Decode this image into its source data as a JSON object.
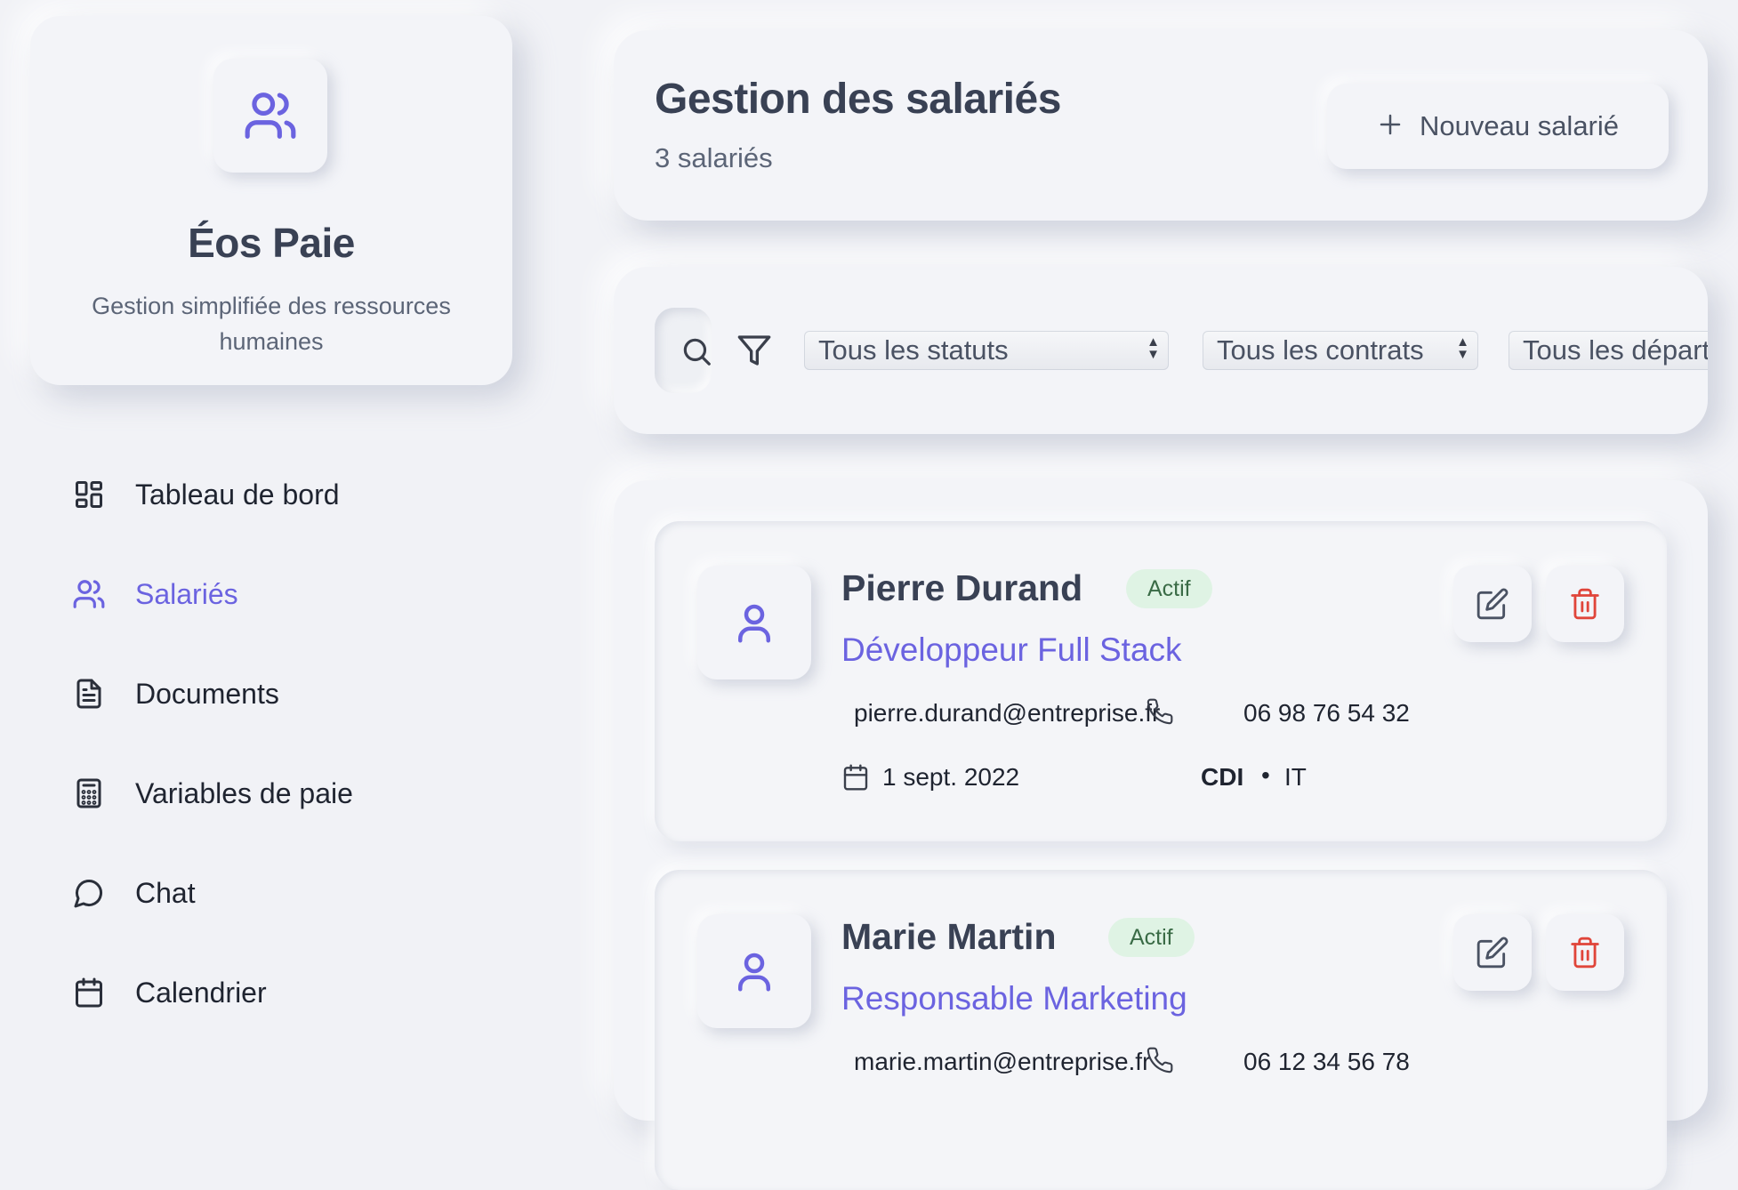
{
  "brand": {
    "name": "Éos Paie",
    "subtitle": "Gestion simplifiée des ressources humaines",
    "icon": "users-icon"
  },
  "sidebar": {
    "items": [
      {
        "label": "Tableau de bord",
        "icon": "dashboard-grid-icon",
        "active": false
      },
      {
        "label": "Salariés",
        "icon": "users-icon",
        "active": true
      },
      {
        "label": "Documents",
        "icon": "document-icon",
        "active": false
      },
      {
        "label": "Variables de paie",
        "icon": "calculator-icon",
        "active": false
      },
      {
        "label": "Chat",
        "icon": "chat-bubble-icon",
        "active": false
      },
      {
        "label": "Calendrier",
        "icon": "calendar-icon",
        "active": false
      }
    ]
  },
  "header": {
    "title": "Gestion des salariés",
    "count": "3 salariés",
    "new_button_label": "Nouveau salarié"
  },
  "filters": {
    "status_select": "Tous les statuts",
    "contract_select": "Tous les contrats",
    "department_select": "Tous les départe"
  },
  "employees": [
    {
      "name": "Pierre Durand",
      "status": "Actif",
      "role": "Développeur Full Stack",
      "email": "pierre.durand@entreprise.fr",
      "phone": "06 98 76 54 32",
      "start_date": "1 sept. 2022",
      "contract": "CDI",
      "separator": "•",
      "department": "IT"
    },
    {
      "name": "Marie Martin",
      "status": "Actif",
      "role": "Responsable Marketing",
      "email": "marie.martin@entreprise.fr",
      "phone": "06 12 34 56 78"
    }
  ],
  "colors": {
    "accent": "#6b63e0",
    "background": "#f1f2f6",
    "status_active_bg": "#dff3e4",
    "delete": "#e0453a"
  }
}
